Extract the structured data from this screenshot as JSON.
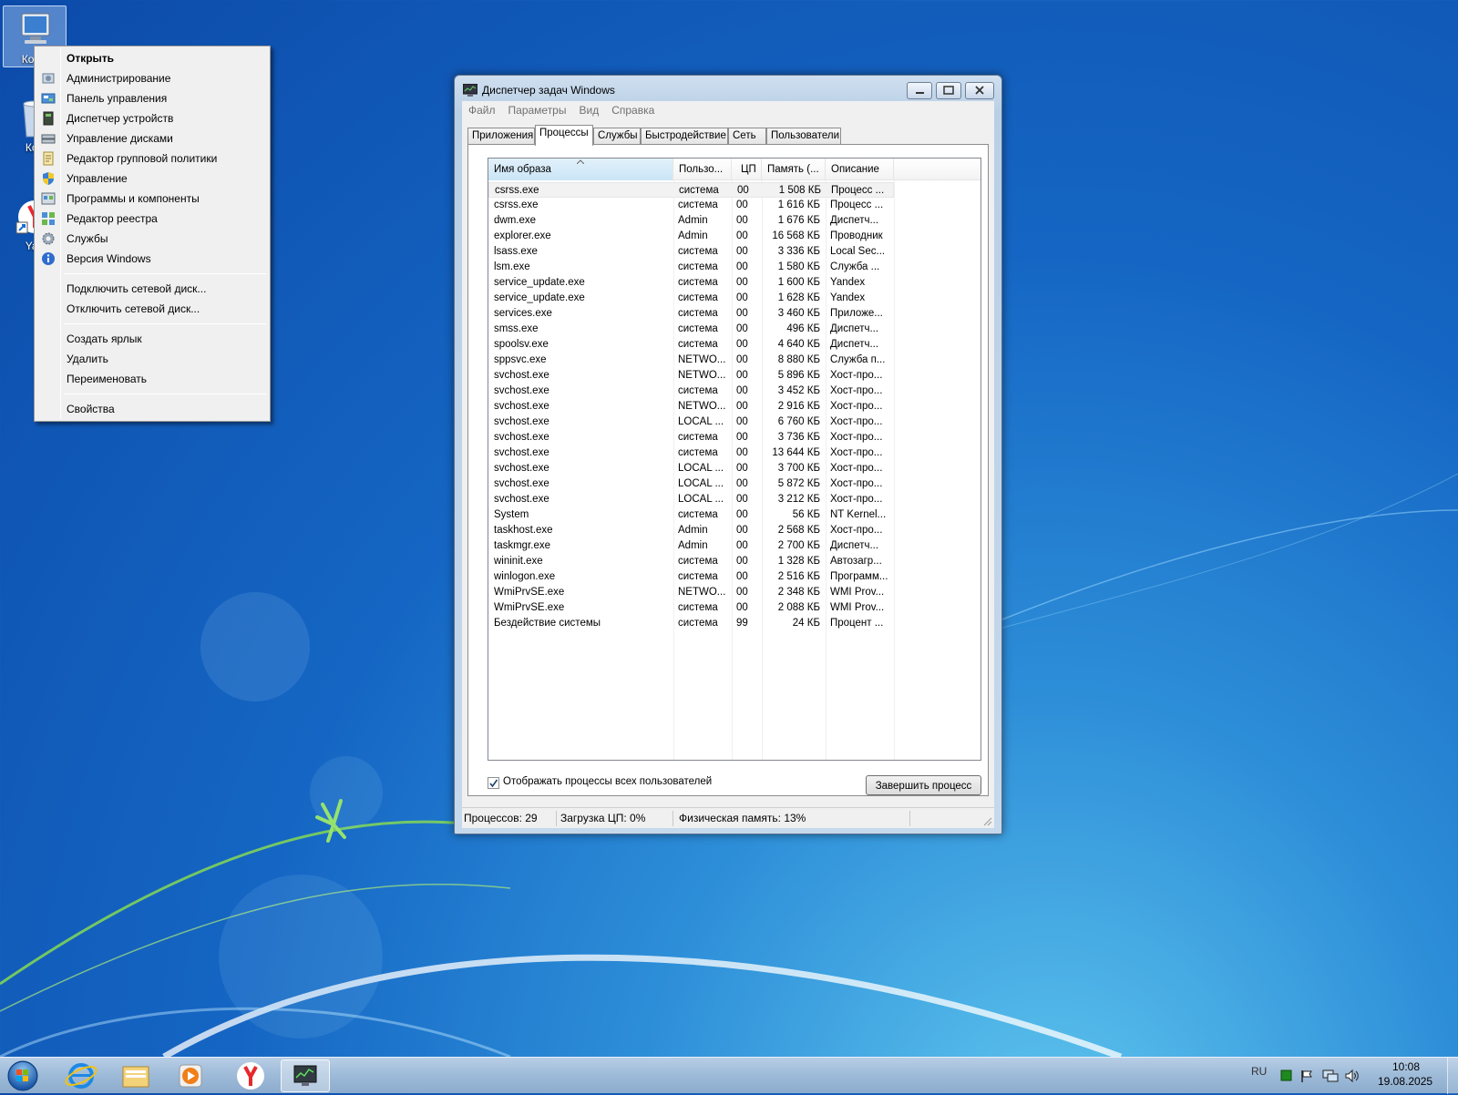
{
  "desktop": {
    "icons": [
      {
        "label": "Комп"
      },
      {
        "label": "Кор"
      },
      {
        "label": "Yan"
      }
    ]
  },
  "context_menu": {
    "items": [
      {
        "label": "Открыть",
        "icon": "none"
      },
      {
        "label": "Администрирование",
        "icon": "admin-tools-icon"
      },
      {
        "label": "Панель управления",
        "icon": "control-panel-icon"
      },
      {
        "label": "Диспетчер устройств",
        "icon": "device-manager-icon"
      },
      {
        "label": "Управление дисками",
        "icon": "disk-management-icon"
      },
      {
        "label": "Редактор групповой политики",
        "icon": "group-policy-icon"
      },
      {
        "label": "Управление",
        "icon": "shield-icon"
      },
      {
        "label": "Программы и компоненты",
        "icon": "programs-icon"
      },
      {
        "label": "Редактор реестра",
        "icon": "registry-editor-icon"
      },
      {
        "label": "Службы",
        "icon": "services-gear-icon"
      },
      {
        "label": "Версия Windows",
        "icon": "info-icon"
      },
      {
        "label": "Подключить сетевой диск...",
        "icon": "none"
      },
      {
        "label": "Отключить сетевой диск...",
        "icon": "none"
      },
      {
        "label": "Создать ярлык",
        "icon": "none"
      },
      {
        "label": "Удалить",
        "icon": "none"
      },
      {
        "label": "Переименовать",
        "icon": "none"
      },
      {
        "label": "Свойства",
        "icon": "none"
      }
    ]
  },
  "task_manager": {
    "title": "Диспетчер задач Windows",
    "menu": [
      "Файл",
      "Параметры",
      "Вид",
      "Справка"
    ],
    "tabs": [
      "Приложения",
      "Процессы",
      "Службы",
      "Быстродействие",
      "Сеть",
      "Пользователи"
    ],
    "active_tab": "Процессы",
    "columns": [
      "Имя образа",
      "Пользо...",
      "ЦП",
      "Память (...",
      "Описание"
    ],
    "processes": [
      {
        "name": "csrss.exe",
        "user": "система",
        "cpu": "00",
        "mem": "1 508 КБ",
        "desc": "Процесс ..."
      },
      {
        "name": "csrss.exe",
        "user": "система",
        "cpu": "00",
        "mem": "1 616 КБ",
        "desc": "Процесс ..."
      },
      {
        "name": "dwm.exe",
        "user": "Admin",
        "cpu": "00",
        "mem": "1 676 КБ",
        "desc": "Диспетч..."
      },
      {
        "name": "explorer.exe",
        "user": "Admin",
        "cpu": "00",
        "mem": "16 568 КБ",
        "desc": "Проводник"
      },
      {
        "name": "lsass.exe",
        "user": "система",
        "cpu": "00",
        "mem": "3 336 КБ",
        "desc": "Local Sec..."
      },
      {
        "name": "lsm.exe",
        "user": "система",
        "cpu": "00",
        "mem": "1 580 КБ",
        "desc": "Служба ..."
      },
      {
        "name": "service_update.exe",
        "user": "система",
        "cpu": "00",
        "mem": "1 600 КБ",
        "desc": "Yandex"
      },
      {
        "name": "service_update.exe",
        "user": "система",
        "cpu": "00",
        "mem": "1 628 КБ",
        "desc": "Yandex"
      },
      {
        "name": "services.exe",
        "user": "система",
        "cpu": "00",
        "mem": "3 460 КБ",
        "desc": "Приложе..."
      },
      {
        "name": "smss.exe",
        "user": "система",
        "cpu": "00",
        "mem": "496 КБ",
        "desc": "Диспетч..."
      },
      {
        "name": "spoolsv.exe",
        "user": "система",
        "cpu": "00",
        "mem": "4 640 КБ",
        "desc": "Диспетч..."
      },
      {
        "name": "sppsvc.exe",
        "user": "NETWO...",
        "cpu": "00",
        "mem": "8 880 КБ",
        "desc": "Служба п..."
      },
      {
        "name": "svchost.exe",
        "user": "NETWO...",
        "cpu": "00",
        "mem": "5 896 КБ",
        "desc": "Хост-про..."
      },
      {
        "name": "svchost.exe",
        "user": "система",
        "cpu": "00",
        "mem": "3 452 КБ",
        "desc": "Хост-про..."
      },
      {
        "name": "svchost.exe",
        "user": "NETWO...",
        "cpu": "00",
        "mem": "2 916 КБ",
        "desc": "Хост-про..."
      },
      {
        "name": "svchost.exe",
        "user": "LOCAL ...",
        "cpu": "00",
        "mem": "6 760 КБ",
        "desc": "Хост-про..."
      },
      {
        "name": "svchost.exe",
        "user": "система",
        "cpu": "00",
        "mem": "3 736 КБ",
        "desc": "Хост-про..."
      },
      {
        "name": "svchost.exe",
        "user": "система",
        "cpu": "00",
        "mem": "13 644 КБ",
        "desc": "Хост-про..."
      },
      {
        "name": "svchost.exe",
        "user": "LOCAL ...",
        "cpu": "00",
        "mem": "3 700 КБ",
        "desc": "Хост-про..."
      },
      {
        "name": "svchost.exe",
        "user": "LOCAL ...",
        "cpu": "00",
        "mem": "5 872 КБ",
        "desc": "Хост-про..."
      },
      {
        "name": "svchost.exe",
        "user": "LOCAL ...",
        "cpu": "00",
        "mem": "3 212 КБ",
        "desc": "Хост-про..."
      },
      {
        "name": "System",
        "user": "система",
        "cpu": "00",
        "mem": "56 КБ",
        "desc": "NT Kernel..."
      },
      {
        "name": "taskhost.exe",
        "user": "Admin",
        "cpu": "00",
        "mem": "2 568 КБ",
        "desc": "Хост-про..."
      },
      {
        "name": "taskmgr.exe",
        "user": "Admin",
        "cpu": "00",
        "mem": "2 700 КБ",
        "desc": "Диспетч..."
      },
      {
        "name": "wininit.exe",
        "user": "система",
        "cpu": "00",
        "mem": "1 328 КБ",
        "desc": "Автозагр..."
      },
      {
        "name": "winlogon.exe",
        "user": "система",
        "cpu": "00",
        "mem": "2 516 КБ",
        "desc": "Программ..."
      },
      {
        "name": "WmiPrvSE.exe",
        "user": "NETWO...",
        "cpu": "00",
        "mem": "2 348 КБ",
        "desc": "WMI Prov..."
      },
      {
        "name": "WmiPrvSE.exe",
        "user": "система",
        "cpu": "00",
        "mem": "2 088 КБ",
        "desc": "WMI Prov..."
      },
      {
        "name": "Бездействие системы",
        "user": "система",
        "cpu": "99",
        "mem": "24 КБ",
        "desc": "Процент ..."
      }
    ],
    "show_all_users_label": "Отображать процессы всех пользователей",
    "show_all_users_checked": true,
    "end_process_label": "Завершить процесс",
    "status": {
      "processes": "Процессов: 29",
      "cpu": "Загрузка ЦП: 0%",
      "memory": "Физическая память: 13%"
    }
  },
  "taskbar": {
    "buttons": [
      {
        "icon": "start-orb-icon"
      },
      {
        "icon": "internet-explorer-icon"
      },
      {
        "icon": "explorer-folder-icon"
      },
      {
        "icon": "media-player-icon"
      },
      {
        "icon": "yandex-browser-icon"
      },
      {
        "icon": "task-manager-icon",
        "active": true
      }
    ],
    "language": "RU",
    "time": "10:08",
    "date": "19.08.2025"
  }
}
